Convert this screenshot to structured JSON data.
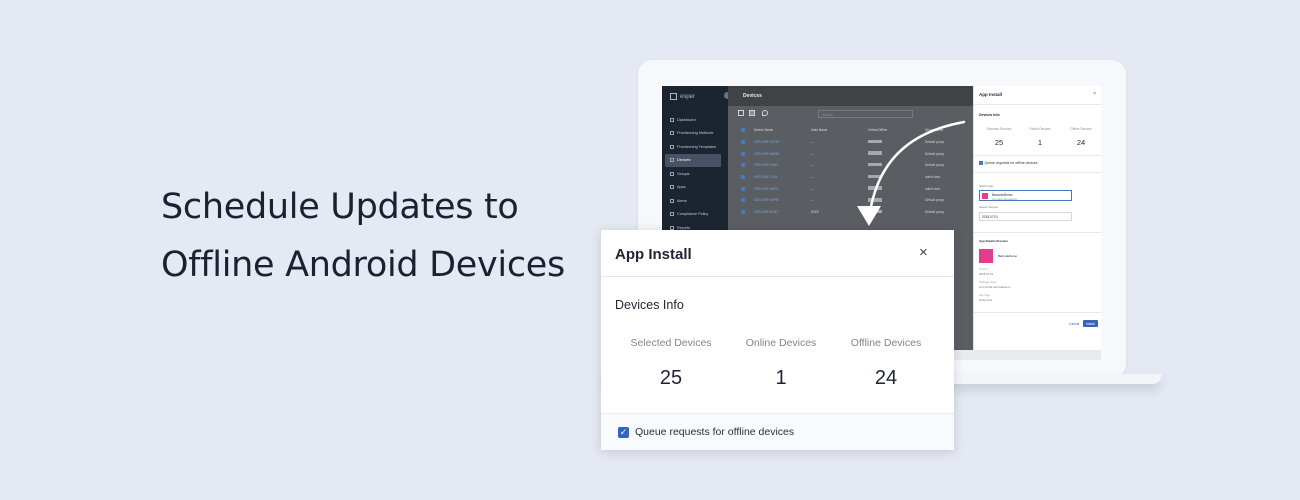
{
  "headline": {
    "line1": "Schedule Updates to",
    "line2": "Offline Android Devices"
  },
  "screen": {
    "brand": "esper",
    "page_title": "Devices",
    "search_placeholder": "Search",
    "nav": [
      {
        "label": "Dashboard",
        "active": false
      },
      {
        "label": "Provisioning Methods",
        "active": false
      },
      {
        "label": "Provisioning Templates",
        "active": false
      },
      {
        "label": "Devices",
        "active": true
      },
      {
        "label": "Groups",
        "active": false
      },
      {
        "label": "Apps",
        "active": false
      },
      {
        "label": "Alerts",
        "active": false
      },
      {
        "label": "Compliance Policy",
        "active": false
      },
      {
        "label": "Reports",
        "active": false
      }
    ],
    "table_headers": [
      "Device Name",
      "Alias Name",
      "Online/Offline",
      "Group Name"
    ],
    "rows": [
      {
        "name": "ESR-EISP-VH7W",
        "alias": "—",
        "group": "Default group"
      },
      {
        "name": "ESR-EISP-8AEW",
        "alias": "—",
        "group": "Default group"
      },
      {
        "name": "ESR-EISP-DA6X",
        "alias": "—",
        "group": "Default group"
      },
      {
        "name": "ESR-EISP-T9JA",
        "alias": "—",
        "group": "admin-test"
      },
      {
        "name": "ESR-EISP-NEZE",
        "alias": "—",
        "group": "admin-test"
      },
      {
        "name": "ESR-EISP-WP9E",
        "alias": "—",
        "group": "Default group"
      },
      {
        "name": "ESR-EISP-WJZY",
        "alias": "WIZE",
        "group": "Default group"
      }
    ],
    "panel": {
      "title": "App Install",
      "close": "×",
      "devices_info": "Devices Info",
      "selected_label": "Selected Devices",
      "online_label": "Online Devices",
      "offline_label": "Offline Devices",
      "selected": "25",
      "online": "1",
      "offline": "24",
      "queue_label": "Queue requests for offline devices",
      "select_app_label": "Select App",
      "app_name": "BarcodeDemo",
      "app_package": "com.esper.barcodedemo",
      "select_version_label": "Select Version",
      "version": "2018.07.01",
      "preview_label": "App Details Preview",
      "preview_name": "BarcodeDemo",
      "version_key": "Version",
      "version_val": "2018.07.01",
      "package_key": "Package name",
      "package_val": "com.shh11.barcodedemo",
      "tags_key": "App Tags",
      "tags_val": "lobbyrobot",
      "cancel": "Cancel",
      "install": "Install"
    }
  },
  "dialog": {
    "title": "App Install",
    "close": "×",
    "subtitle": "Devices Info",
    "selected_label": "Selected Devices",
    "online_label": "Online Devices",
    "offline_label": "Offline Devices",
    "selected": "25",
    "online": "1",
    "offline": "24",
    "queue_label": "Queue requests for offline devices",
    "queue_checked": true
  },
  "colors": {
    "background": "#e5e9f3",
    "accent": "#3465b8",
    "app_icon": "#e23d8f",
    "sidebar": "#1c2431"
  }
}
